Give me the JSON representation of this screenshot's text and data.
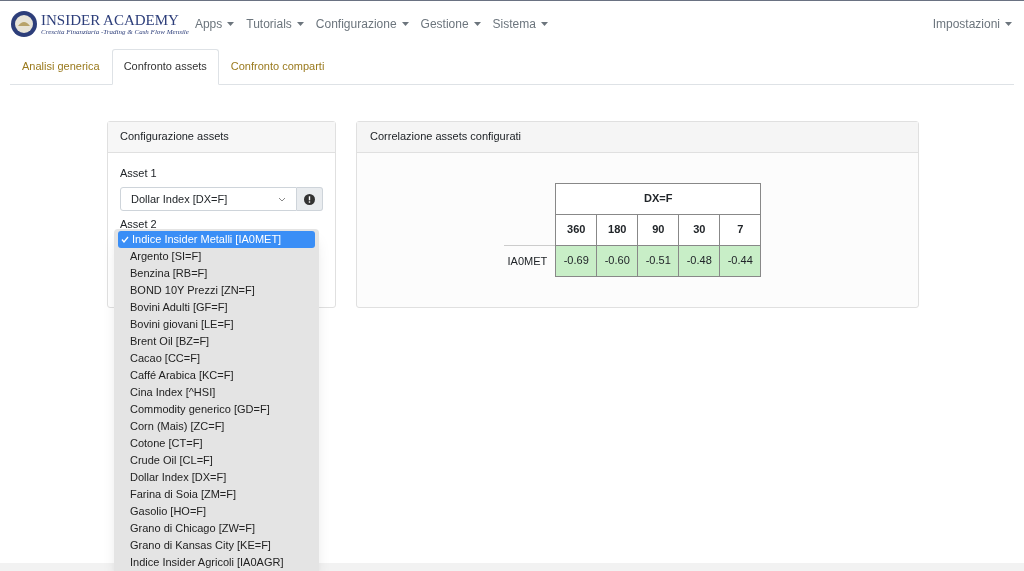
{
  "brand": {
    "name": "INSIDER ACADEMY",
    "tagline": "Crescita Finanziaria -Trading & Cash Flow Mensile"
  },
  "menu": [
    {
      "label": "Apps"
    },
    {
      "label": "Tutorials"
    },
    {
      "label": "Configurazione"
    },
    {
      "label": "Gestione"
    },
    {
      "label": "Sistema"
    }
  ],
  "settings_menu": {
    "label": "Impostazioni"
  },
  "tabs": [
    {
      "label": "Analisi generica",
      "selected": false
    },
    {
      "label": "Confronto assets",
      "selected": true
    },
    {
      "label": "Confronto comparti",
      "selected": false
    }
  ],
  "config_card": {
    "title": "Configurazione assets",
    "asset1_label": "Asset 1",
    "asset1_value": "Dollar Index [DX=F]",
    "asset2_label": "Asset 2",
    "asset2_options": [
      {
        "label": "Indice Insider Metalli [IA0MET]",
        "selected": true
      },
      {
        "label": "Argento [SI=F]",
        "selected": false
      },
      {
        "label": "Benzina [RB=F]",
        "selected": false
      },
      {
        "label": "BOND 10Y Prezzi [ZN=F]",
        "selected": false
      },
      {
        "label": "Bovini Adulti [GF=F]",
        "selected": false
      },
      {
        "label": "Bovini giovani [LE=F]",
        "selected": false
      },
      {
        "label": "Brent Oil [BZ=F]",
        "selected": false
      },
      {
        "label": "Cacao [CC=F]",
        "selected": false
      },
      {
        "label": "Caffé Arabica [KC=F]",
        "selected": false
      },
      {
        "label": "Cina Index [^HSI]",
        "selected": false
      },
      {
        "label": "Commodity generico [GD=F]",
        "selected": false
      },
      {
        "label": "Corn (Mais) [ZC=F]",
        "selected": false
      },
      {
        "label": "Cotone [CT=F]",
        "selected": false
      },
      {
        "label": "Crude Oil [CL=F]",
        "selected": false
      },
      {
        "label": "Dollar Index [DX=F]",
        "selected": false
      },
      {
        "label": "Farina di Soia [ZM=F]",
        "selected": false
      },
      {
        "label": "Gasolio [HO=F]",
        "selected": false
      },
      {
        "label": "Grano di Chicago [ZW=F]",
        "selected": false
      },
      {
        "label": "Grano di Kansas City [KE=F]",
        "selected": false
      },
      {
        "label": "Indice Insider Agricoli [IA0AGR]",
        "selected": false
      }
    ]
  },
  "correlation_card": {
    "title": "Correlazione assets configurati",
    "group_header": "DX=F",
    "columns": [
      "360",
      "180",
      "90",
      "30",
      "7"
    ],
    "rows": [
      {
        "label": "IA0MET",
        "values": [
          "-0.69",
          "-0.60",
          "-0.51",
          "-0.48",
          "-0.44"
        ]
      }
    ]
  }
}
